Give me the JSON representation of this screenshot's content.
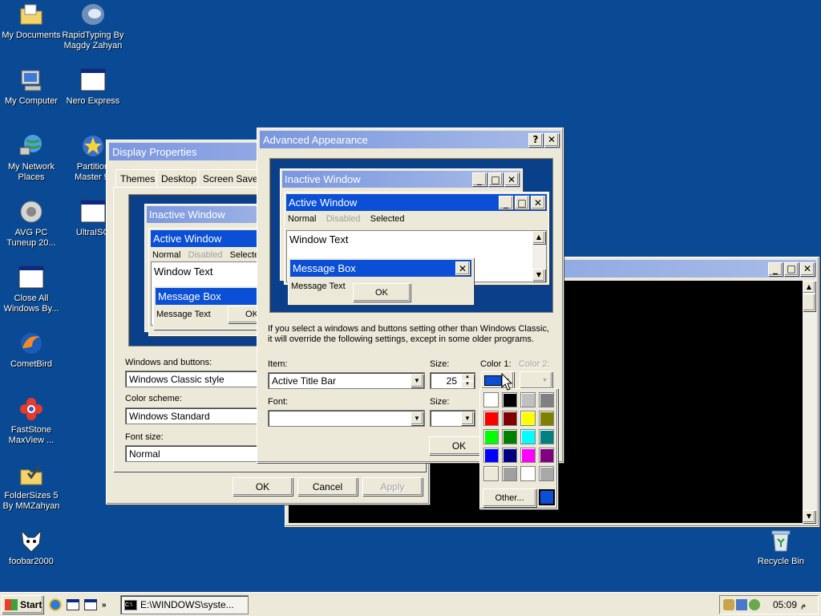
{
  "desktop": {
    "icons": [
      {
        "label": "My Documents"
      },
      {
        "label": "RapidTyping By\nMagdy Zahyan"
      },
      {
        "label": "My Computer"
      },
      {
        "label": "Nero Express"
      },
      {
        "label": "My Network\nPlaces"
      },
      {
        "label": "Partition\nMaster 9."
      },
      {
        "label": "AVG PC\nTuneup 20..."
      },
      {
        "label": "UltraISO"
      },
      {
        "label": "Close All\nWindows By..."
      },
      {
        "label": "CometBird"
      },
      {
        "label": "FastStone\nMaxView ..."
      },
      {
        "label": "FolderSizes 5\nBy MMZahyan"
      },
      {
        "label": "foobar2000"
      },
      {
        "label": "Recycle Bin"
      }
    ]
  },
  "display_properties": {
    "title": "Display Properties",
    "tabs": [
      "Themes",
      "Desktop",
      "Screen Saver"
    ],
    "preview": {
      "inactive_title": "Inactive Window",
      "active_title": "Active Window",
      "menu": [
        "Normal",
        "Disabled",
        "Selecte"
      ],
      "window_text": "Window Text",
      "msgbox_title": "Message Box",
      "msgbox_text": "Message Text",
      "ok": "OK"
    },
    "windows_buttons_label": "Windows and buttons:",
    "windows_buttons_value": "Windows Classic style",
    "color_scheme_label": "Color scheme:",
    "color_scheme_value": "Windows Standard",
    "font_size_label": "Font size:",
    "font_size_value": "Normal",
    "ok": "OK",
    "cancel": "Cancel",
    "apply": "Apply"
  },
  "advanced": {
    "title": "Advanced Appearance",
    "help": "?",
    "close": "✕",
    "preview": {
      "inactive_title": "Inactive Window",
      "active_title": "Active Window",
      "menu_normal": "Normal",
      "menu_disabled": "Disabled",
      "menu_selected": "Selected",
      "window_text": "Window Text",
      "msgbox_title": "Message Box",
      "msgbox_text": "Message Text",
      "ok": "OK"
    },
    "info": "If you select a windows and buttons setting other than Windows Classic,\nit will override the following settings, except in some older programs.",
    "item_label": "Item:",
    "item_value": "Active Title Bar",
    "size_label": "Size:",
    "size_value": "25",
    "color1_label": "Color 1:",
    "color2_label": "Color 2:",
    "font_label": "Font:",
    "font_size_label": "Size:",
    "ok": "OK",
    "color1": "#0a4fd6"
  },
  "palette": {
    "colors": [
      "#ffffff",
      "#000000",
      "#c0c0c0",
      "#808080",
      "#ff0000",
      "#800000",
      "#ffff00",
      "#808000",
      "#00ff00",
      "#008000",
      "#00ffff",
      "#008080",
      "#0000ff",
      "#000080",
      "#ff00ff",
      "#800080",
      "#ece9d8",
      "#a0a0a0",
      "#ffffff",
      "#a9a9a9"
    ],
    "other_label": "Other...",
    "custom_color": "#0a4fd6"
  },
  "taskbar": {
    "start": "Start",
    "task": "E:\\WINDOWS\\syste...",
    "clock": "05:09",
    "clock_suffix": "م"
  }
}
